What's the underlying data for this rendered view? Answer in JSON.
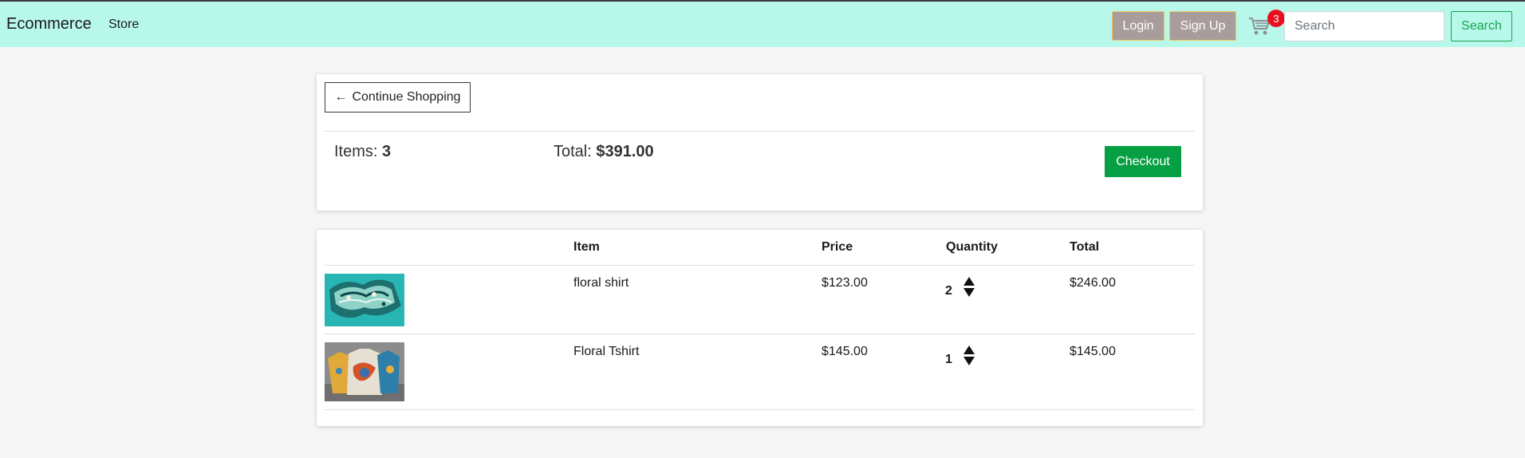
{
  "navbar": {
    "brand": "Ecommerce",
    "store_link": "Store",
    "login_label": "Login",
    "signup_label": "Sign Up",
    "cart_count": "3",
    "search_placeholder": "Search",
    "search_button": "Search",
    "background_color": "#b8f8ea"
  },
  "summary": {
    "continue_label": "Continue Shopping",
    "items_label": "Items:",
    "items_count": "3",
    "total_label": "Total:",
    "total_value": "$391.00",
    "checkout_label": "Checkout",
    "checkout_color": "#079f43"
  },
  "table": {
    "headers": {
      "item": "Item",
      "price": "Price",
      "quantity": "Quantity",
      "total": "Total"
    },
    "rows": [
      {
        "name": "floral shirt",
        "price": "$123.00",
        "quantity": "2",
        "total": "$246.00",
        "image": "floral-shirt-thumbnail"
      },
      {
        "name": "Floral Tshirt",
        "price": "$145.00",
        "quantity": "1",
        "total": "$145.00",
        "image": "floral-tshirt-thumbnail"
      }
    ]
  },
  "icons": {
    "cart": "shopping-cart-icon",
    "back": "arrow-left-icon",
    "increase": "arrow-up-icon",
    "decrease": "arrow-down-icon"
  }
}
